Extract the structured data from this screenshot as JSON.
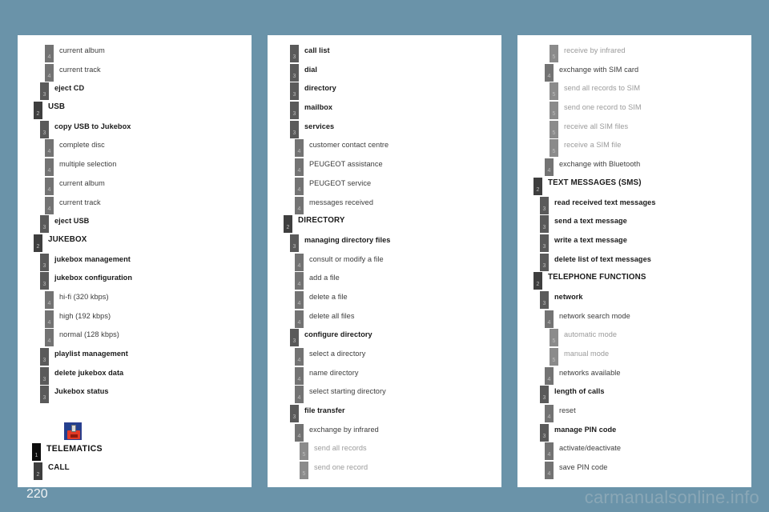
{
  "page": {
    "number": "220",
    "watermark": "carmanualsonline.info",
    "background_color": "#6a93a9",
    "panel_color": "#ffffff"
  },
  "level_colors": {
    "1": "#0d0d0d",
    "2": "#3e3e3e",
    "3": "#5a5a5a",
    "4": "#737373",
    "5": "#8b8b8b"
  },
  "columns": [
    {
      "name": "column-left",
      "rows": [
        {
          "level": 4,
          "label": "current album"
        },
        {
          "level": 4,
          "label": "current track"
        },
        {
          "level": 3,
          "label": "eject CD"
        },
        {
          "level": 2,
          "label": "USB"
        },
        {
          "level": 3,
          "label": "copy USB to Jukebox"
        },
        {
          "level": 4,
          "label": "complete disc"
        },
        {
          "level": 4,
          "label": "multiple selection"
        },
        {
          "level": 4,
          "label": "current album"
        },
        {
          "level": 4,
          "label": "current track"
        },
        {
          "level": 3,
          "label": "eject USB"
        },
        {
          "level": 2,
          "label": "JUKEBOX"
        },
        {
          "level": 3,
          "label": "jukebox management"
        },
        {
          "level": 3,
          "label": "jukebox configuration"
        },
        {
          "level": 4,
          "label": "hi-fi (320 kbps)"
        },
        {
          "level": 4,
          "label": "high (192 kbps)"
        },
        {
          "level": 4,
          "label": "normal (128 kbps)"
        },
        {
          "level": 3,
          "label": "playlist management"
        },
        {
          "level": 3,
          "label": "delete jukebox data"
        },
        {
          "level": 3,
          "label": "Jukebox status"
        },
        {
          "type": "spacer"
        },
        {
          "type": "icon",
          "icon": "telematics-phone-icon"
        },
        {
          "level": 1,
          "label": "TELEMATICS"
        },
        {
          "level": 2,
          "label": "CALL"
        }
      ]
    },
    {
      "name": "column-middle",
      "rows": [
        {
          "level": 3,
          "label": "call list"
        },
        {
          "level": 3,
          "label": "dial"
        },
        {
          "level": 3,
          "label": "directory"
        },
        {
          "level": 3,
          "label": "mailbox"
        },
        {
          "level": 3,
          "label": "services"
        },
        {
          "level": 4,
          "label": "customer contact centre"
        },
        {
          "level": 4,
          "label": "PEUGEOT assistance"
        },
        {
          "level": 4,
          "label": "PEUGEOT service"
        },
        {
          "level": 4,
          "label": "messages received"
        },
        {
          "level": 2,
          "label": "DIRECTORY"
        },
        {
          "level": 3,
          "label": "managing directory files"
        },
        {
          "level": 4,
          "label": "consult or modify a file"
        },
        {
          "level": 4,
          "label": "add a file"
        },
        {
          "level": 4,
          "label": "delete a file"
        },
        {
          "level": 4,
          "label": "delete all files"
        },
        {
          "level": 3,
          "label": "configure directory"
        },
        {
          "level": 4,
          "label": "select a directory"
        },
        {
          "level": 4,
          "label": "name directory"
        },
        {
          "level": 4,
          "label": "select starting directory"
        },
        {
          "level": 3,
          "label": "file transfer"
        },
        {
          "level": 4,
          "label": "exchange by infrared"
        },
        {
          "level": 5,
          "label": "send all records"
        },
        {
          "level": 5,
          "label": "send one record"
        }
      ]
    },
    {
      "name": "column-right",
      "rows": [
        {
          "level": 5,
          "label": "receive by infrared"
        },
        {
          "level": 4,
          "label": "exchange with SIM card"
        },
        {
          "level": 5,
          "label": "send all records to SIM"
        },
        {
          "level": 5,
          "label": "send one record to SIM"
        },
        {
          "level": 5,
          "label": "receive all SIM files"
        },
        {
          "level": 5,
          "label": "receive a SIM file"
        },
        {
          "level": 4,
          "label": "exchange with Bluetooth"
        },
        {
          "level": 2,
          "label": "TEXT MESSAGES (SMS)"
        },
        {
          "level": 3,
          "label": "read received text messages"
        },
        {
          "level": 3,
          "label": "send a text message"
        },
        {
          "level": 3,
          "label": "write a text message"
        },
        {
          "level": 3,
          "label": "delete list of text messages"
        },
        {
          "level": 2,
          "label": "TELEPHONE FUNCTIONS"
        },
        {
          "level": 3,
          "label": "network"
        },
        {
          "level": 4,
          "label": "network search mode"
        },
        {
          "level": 5,
          "label": "automatic mode"
        },
        {
          "level": 5,
          "label": "manual mode"
        },
        {
          "level": 4,
          "label": "networks available"
        },
        {
          "level": 3,
          "label": "length of calls"
        },
        {
          "level": 4,
          "label": "reset"
        },
        {
          "level": 3,
          "label": "manage PIN code"
        },
        {
          "level": 4,
          "label": "activate/deactivate"
        },
        {
          "level": 4,
          "label": "save PIN code"
        }
      ]
    }
  ]
}
